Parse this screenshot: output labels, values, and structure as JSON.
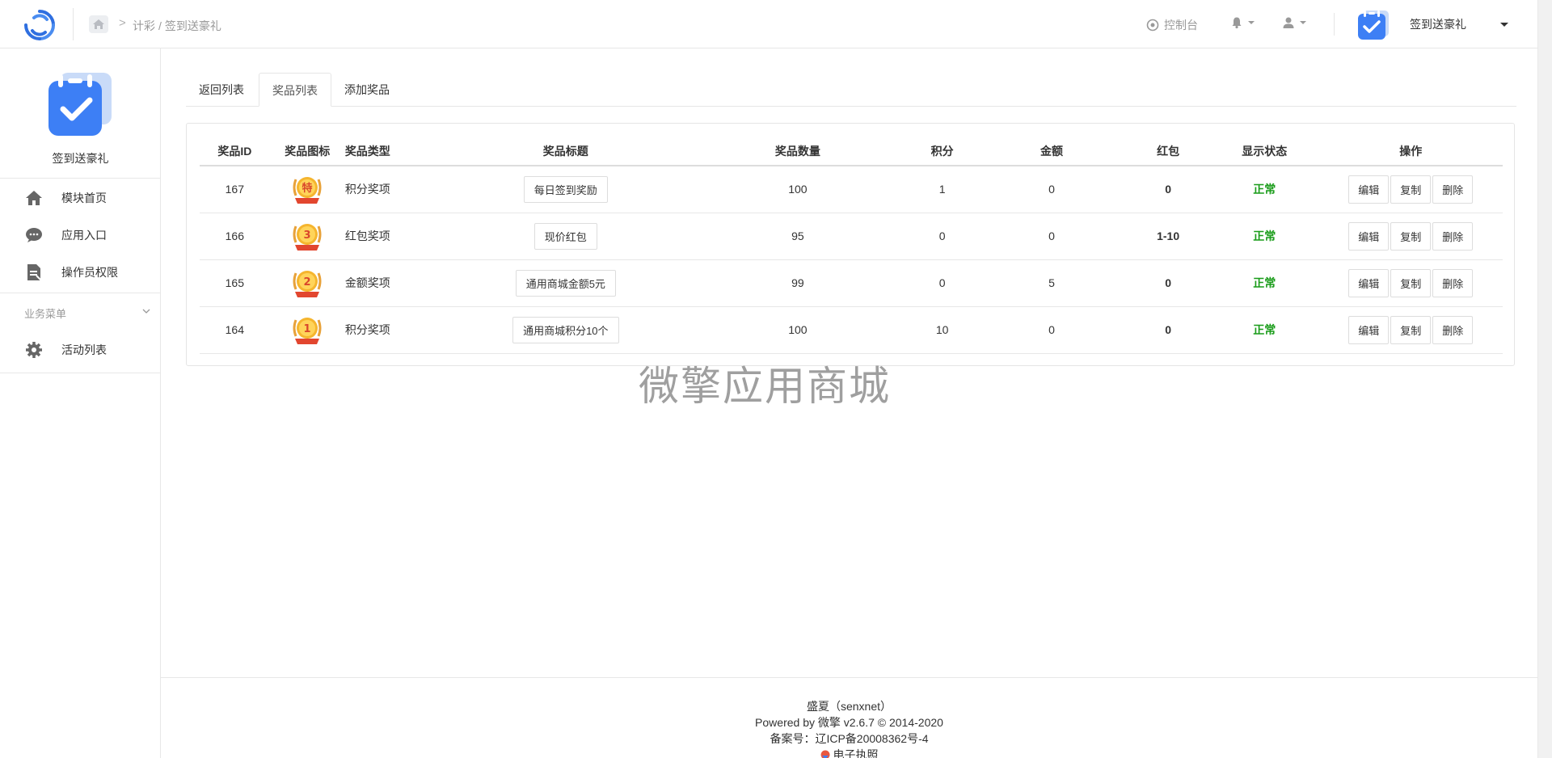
{
  "header": {
    "breadcrumb": [
      "计彩",
      "/",
      "签到送豪礼"
    ],
    "console_label": "控制台",
    "app_name": "签到送豪礼"
  },
  "sidebar": {
    "module_title": "签到送豪礼",
    "items": [
      {
        "label": "模块首页",
        "icon": "home-icon"
      },
      {
        "label": "应用入口",
        "icon": "chat-icon"
      },
      {
        "label": "操作员权限",
        "icon": "document-icon"
      }
    ],
    "group_label": "业务菜单",
    "group_items": [
      {
        "label": "活动列表",
        "icon": "gear-icon"
      }
    ]
  },
  "tabs": [
    {
      "label": "返回列表",
      "active": false
    },
    {
      "label": "奖品列表",
      "active": true
    },
    {
      "label": "添加奖品",
      "active": false
    }
  ],
  "table": {
    "headers": [
      "奖品ID",
      "奖品图标",
      "奖品类型",
      "奖品标题",
      "奖品数量",
      "积分",
      "金额",
      "红包",
      "显示状态",
      "操作"
    ],
    "rows": [
      {
        "id": "167",
        "medal": "特",
        "type": "积分奖项",
        "title": "每日签到奖励",
        "qty": "100",
        "points": "1",
        "amount": "0",
        "redpack": "0",
        "status": "正常"
      },
      {
        "id": "166",
        "medal": "3",
        "type": "红包奖项",
        "title": "现价红包",
        "qty": "95",
        "points": "0",
        "amount": "0",
        "redpack": "1-10",
        "status": "正常"
      },
      {
        "id": "165",
        "medal": "2",
        "type": "金额奖项",
        "title": "通用商城金额5元",
        "qty": "99",
        "points": "0",
        "amount": "5",
        "redpack": "0",
        "status": "正常"
      },
      {
        "id": "164",
        "medal": "1",
        "type": "积分奖项",
        "title": "通用商城积分10个",
        "qty": "100",
        "points": "10",
        "amount": "0",
        "redpack": "0",
        "status": "正常"
      }
    ],
    "actions": [
      "编辑",
      "复制",
      "删除"
    ]
  },
  "watermark": "微擎应用商城",
  "footer": {
    "line1": "盛夏（senxnet）",
    "line2": "Powered by 微擎 v2.6.7 © 2014-2020",
    "line3": "备案号：辽ICP备20008362号-4",
    "line4": "电子执照"
  },
  "colors": {
    "status_green": "#1a9c1a",
    "brand_blue": "#3d7ff5"
  }
}
